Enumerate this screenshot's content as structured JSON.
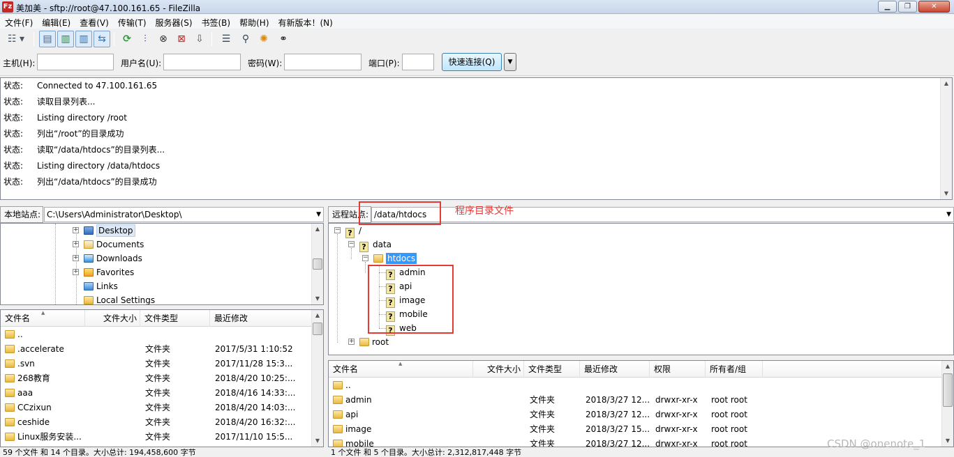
{
  "window": {
    "title": "美加美 - sftp://root@47.100.161.65 - FileZilla",
    "app_icon_glyph": "Fz"
  },
  "menu": [
    "文件(F)",
    "编辑(E)",
    "查看(V)",
    "传输(T)",
    "服务器(S)",
    "书签(B)",
    "帮助(H)",
    "有新版本！(N)"
  ],
  "quickconnect": {
    "host_label": "主机(H):",
    "user_label": "用户名(U):",
    "password_label": "密码(W):",
    "port_label": "端口(P):",
    "host_value": "",
    "user_value": "",
    "password_value": "",
    "port_value": "",
    "connect_label": "快速连接(Q)",
    "dropdown_glyph": "▼"
  },
  "log": [
    {
      "label": "状态:",
      "text": "Connected to 47.100.161.65"
    },
    {
      "label": "状态:",
      "text": "读取目录列表..."
    },
    {
      "label": "状态:",
      "text": "Listing directory /root"
    },
    {
      "label": "状态:",
      "text": "列出“/root”的目录成功"
    },
    {
      "label": "状态:",
      "text": "读取“/data/htdocs”的目录列表..."
    },
    {
      "label": "状态:",
      "text": "Listing directory /data/htdocs"
    },
    {
      "label": "状态:",
      "text": "列出“/data/htdocs”的目录成功"
    }
  ],
  "local": {
    "site_label": "本地站点:",
    "path": "C:\\Users\\Administrator\\Desktop\\",
    "tree": [
      {
        "label": "Desktop",
        "icon": "desktop-icon"
      },
      {
        "label": "Documents",
        "icon": "documents-icon"
      },
      {
        "label": "Downloads",
        "icon": "downloads-icon"
      },
      {
        "label": "Favorites",
        "icon": "favorites-icon"
      },
      {
        "label": "Links",
        "icon": "links-icon"
      },
      {
        "label": "Local Settings",
        "icon": "folder-icon"
      }
    ],
    "columns": [
      "文件名",
      "文件大小",
      "文件类型",
      "最近修改"
    ],
    "rows": [
      {
        "name": "..",
        "size": "",
        "type": "",
        "modified": ""
      },
      {
        "name": ".accelerate",
        "size": "",
        "type": "文件夹",
        "modified": "2017/5/31 1:10:52"
      },
      {
        "name": ".svn",
        "size": "",
        "type": "文件夹",
        "modified": "2017/11/28 15:3..."
      },
      {
        "name": "268教育",
        "size": "",
        "type": "文件夹",
        "modified": "2018/4/20 10:25:..."
      },
      {
        "name": "aaa",
        "size": "",
        "type": "文件夹",
        "modified": "2018/4/16 14:33:..."
      },
      {
        "name": "CCzixun",
        "size": "",
        "type": "文件夹",
        "modified": "2018/4/20 14:03:..."
      },
      {
        "name": "ceshide",
        "size": "",
        "type": "文件夹",
        "modified": "2018/4/20 16:32:..."
      },
      {
        "name": "Linux服务安装...",
        "size": "",
        "type": "文件夹",
        "modified": "2017/11/10 15:5..."
      }
    ],
    "status": "59 个文件 和 14 个目录。大小总计: 194,458,600 字节"
  },
  "remote": {
    "site_label": "远程站点:",
    "path": "/data/htdocs",
    "tree": {
      "root": "/",
      "data": "data",
      "htdocs": "htdocs",
      "children": [
        "admin",
        "api",
        "image",
        "mobile",
        "web"
      ],
      "root_dir": "root"
    },
    "columns": [
      "文件名",
      "文件大小",
      "文件类型",
      "最近修改",
      "权限",
      "所有者/组"
    ],
    "rows": [
      {
        "name": "..",
        "size": "",
        "type": "",
        "modified": "",
        "perms": "",
        "owner": ""
      },
      {
        "name": "admin",
        "size": "",
        "type": "文件夹",
        "modified": "2018/3/27 12...",
        "perms": "drwxr-xr-x",
        "owner": "root root"
      },
      {
        "name": "api",
        "size": "",
        "type": "文件夹",
        "modified": "2018/3/27 12...",
        "perms": "drwxr-xr-x",
        "owner": "root root"
      },
      {
        "name": "image",
        "size": "",
        "type": "文件夹",
        "modified": "2018/3/27 15...",
        "perms": "drwxr-xr-x",
        "owner": "root root"
      },
      {
        "name": "mobile",
        "size": "",
        "type": "文件夹",
        "modified": "2018/3/27 12...",
        "perms": "drwxr-xr-x",
        "owner": "root root"
      }
    ],
    "status": "1 个文件 和 5 个目录。大小总计: 2,312,817,448 字节"
  },
  "annotation": {
    "text": "程序目录文件",
    "color": "#e53935"
  },
  "watermark": "CSDN @onenote_1"
}
